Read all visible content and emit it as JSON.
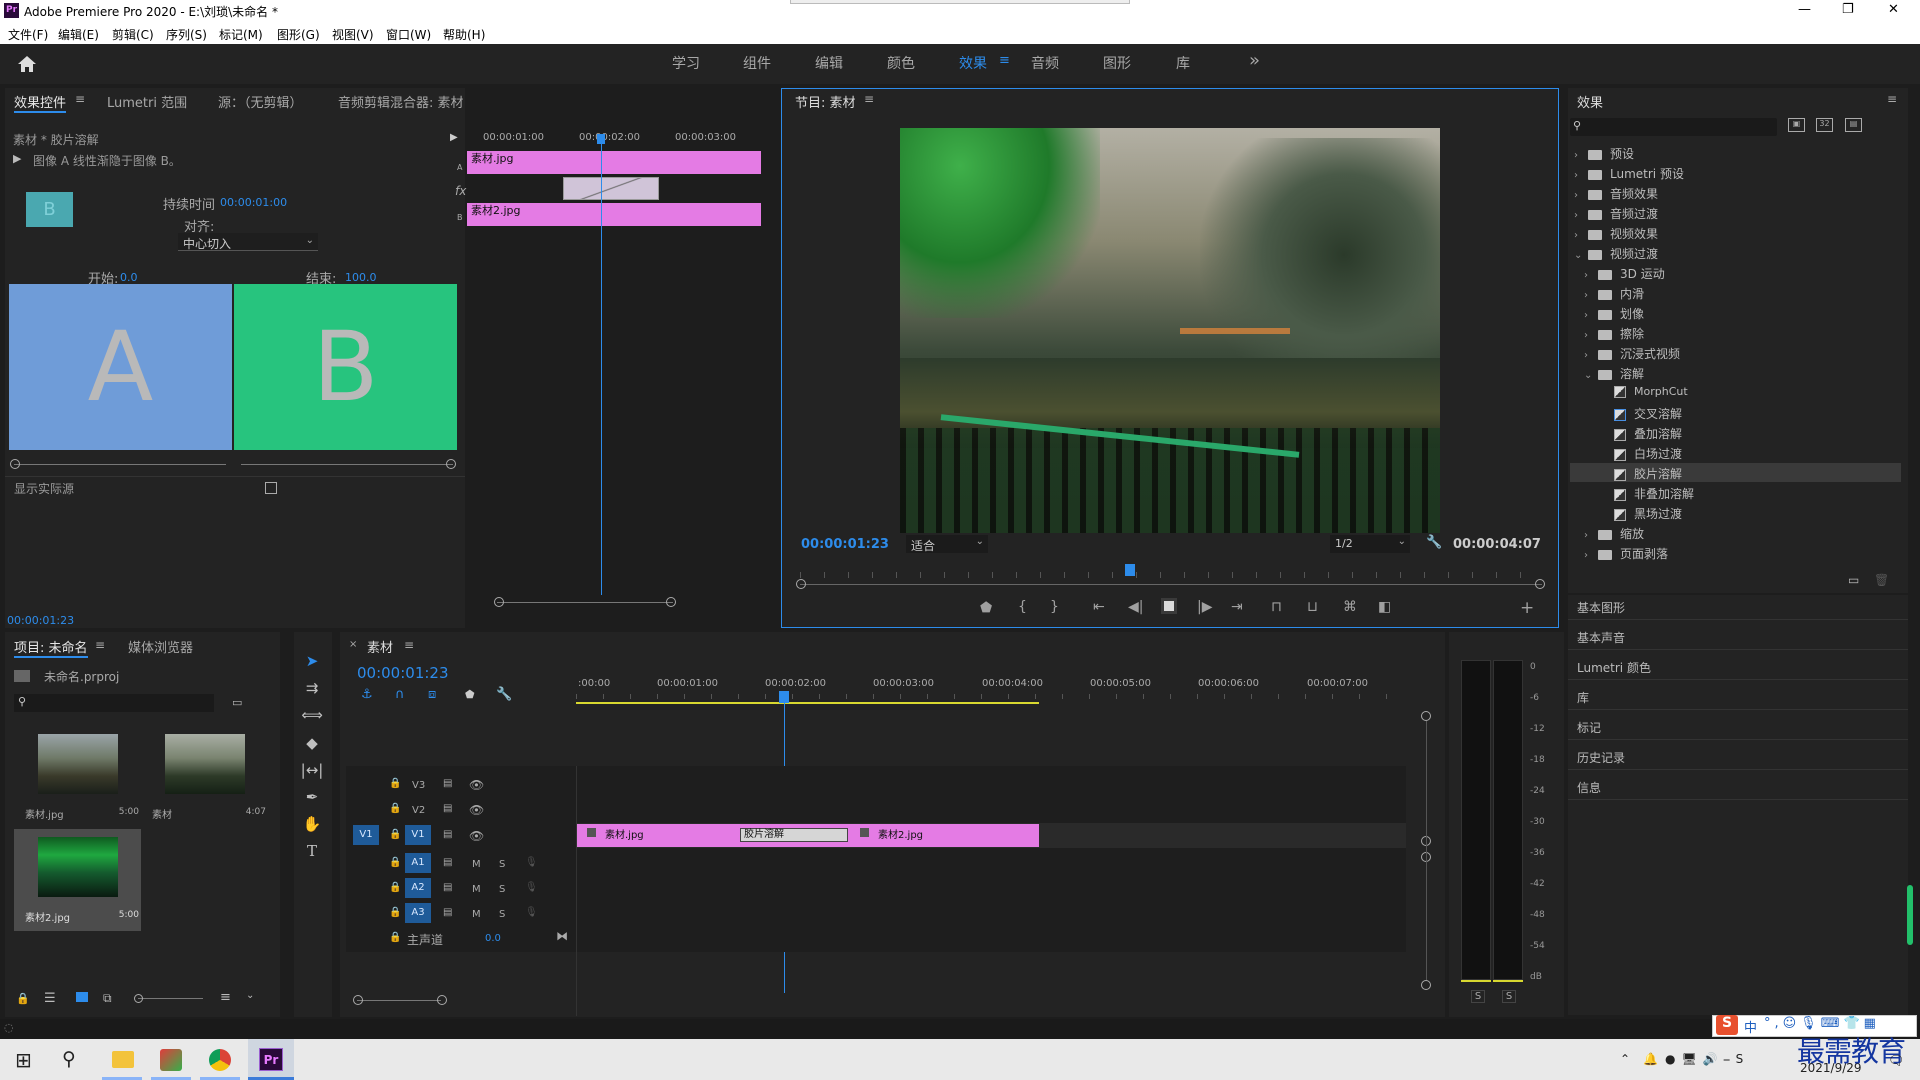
{
  "window": {
    "title": "Adobe Premiere Pro 2020 - E:\\刘琐\\未命名 *",
    "app_icon": "Pr",
    "min": "—",
    "max": "❐",
    "close": "✕"
  },
  "menu": [
    "文件(F)",
    "编辑(E)",
    "剪辑(C)",
    "序列(S)",
    "标记(M)",
    "图形(G)",
    "视图(V)",
    "窗口(W)",
    "帮助(H)"
  ],
  "workspaces": [
    "学习",
    "组件",
    "编辑",
    "颜色",
    "效果",
    "音频",
    "图形",
    "库"
  ],
  "workspace_active": "效果",
  "workspace_more": "»",
  "effect_controls": {
    "tabs": [
      "效果控件",
      "Lumetri 范围",
      "源：（无剪辑）",
      "音频剪辑混合器: 素材"
    ],
    "clip_label": "素材 * 胶片溶解",
    "desc": "图像 A 线性渐隐于图像 B。",
    "duration_label": "持续时间",
    "duration_value": "00:00:01:00",
    "align_label": "对齐:",
    "align_value": "中心切入",
    "start_label": "开始:",
    "start_value": "0.0",
    "end_label": "结束:",
    "end_value": "100.0",
    "a_text": "A",
    "b_text": "B",
    "thumb_text": "B",
    "show_source_label": "显示实际源",
    "timecode": "00:00:01:23",
    "ruler": [
      "00:00:01:00",
      "00:00:02:00",
      "00:00:03:00"
    ],
    "clip_a": "素材.jpg",
    "clip_b": "素材2.jpg",
    "track_a": "A",
    "track_b": "B",
    "fx_label": "fx"
  },
  "program": {
    "title": "节目: 素材",
    "timecode": "00:00:01:23",
    "fit": "适合",
    "resolution": "1/2",
    "duration": "00:00:04:07"
  },
  "effects": {
    "title": "效果",
    "search_placeholder": "",
    "top": [
      "预设",
      "Lumetri 预设",
      "音频效果",
      "音频过渡",
      "视频效果",
      "视频过渡"
    ],
    "video_transitions": [
      "3D 运动",
      "内滑",
      "划像",
      "擦除",
      "沉浸式视频",
      "溶解"
    ],
    "dissolve": [
      "MorphCut",
      "交叉溶解",
      "叠加溶解",
      "白场过渡",
      "胶片溶解",
      "非叠加溶解",
      "黑场过渡"
    ],
    "dissolve_selected": "胶片溶解",
    "after": [
      "缩放",
      "页面剥落"
    ],
    "sections": [
      "基本图形",
      "基本声音",
      "Lumetri 颜色",
      "库",
      "标记",
      "历史记录",
      "信息"
    ]
  },
  "project": {
    "tabs": [
      "项目: 未命名",
      "媒体浏览器"
    ],
    "file": "未命名.prproj",
    "items": [
      {
        "name": "素材.jpg",
        "dur": "5:00"
      },
      {
        "name": "素材",
        "dur": "4:07"
      },
      {
        "name": "素材2.jpg",
        "dur": "5:00"
      }
    ]
  },
  "timeline": {
    "tab": "素材",
    "timecode": "00:00:01:23",
    "ruler": [
      ":00:00",
      "00:00:01:00",
      "00:00:02:00",
      "00:00:03:00",
      "00:00:04:00",
      "00:00:05:00",
      "00:00:06:00",
      "00:00:07:00"
    ],
    "video_tracks": [
      "V3",
      "V2",
      "V1"
    ],
    "audio_tracks": [
      "A1",
      "A2",
      "A3"
    ],
    "source_v": "V1",
    "master_label": "主声道",
    "master_value": "0.0",
    "mute": "M",
    "solo": "S",
    "clip1": "素材.jpg",
    "clip2": "素材2.jpg",
    "transition": "胶片溶解"
  },
  "meter": {
    "scale": [
      "0",
      "-6",
      "-12",
      "-18",
      "-24",
      "-30",
      "-36",
      "-42",
      "-48",
      "-54",
      "dB"
    ],
    "solo": [
      "S",
      "S"
    ]
  },
  "taskbar": {
    "time": "2021/9/29",
    "ime": "中",
    "watermark": "最需教育",
    "win_icon": "⊞",
    "search_icon": "⚲"
  }
}
